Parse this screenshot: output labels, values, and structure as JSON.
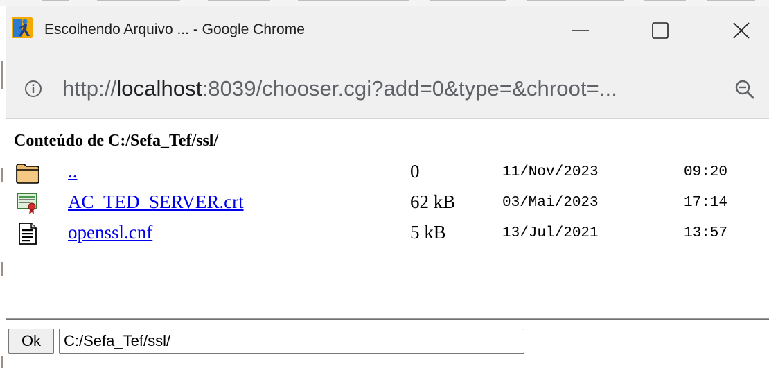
{
  "window": {
    "title": "Escolhendo Arquivo ... - Google Chrome",
    "url_prefix": "http://",
    "url_host": "localhost",
    "url_rest": ":8039/chooser.cgi?add=0&type=&chroot=..."
  },
  "content": {
    "heading": "Conteúdo de C:/Sefa_Tef/ssl/",
    "files": [
      {
        "name": "..",
        "size": "0",
        "date": "11/Nov/2023",
        "time": "09:20",
        "icon": "folder-icon"
      },
      {
        "name": "AC_TED_SERVER.crt",
        "size": "62 kB",
        "date": "03/Mai/2023",
        "time": "17:14",
        "icon": "certificate-icon"
      },
      {
        "name": "openssl.cnf",
        "size": "5 kB",
        "date": "13/Jul/2021",
        "time": "13:57",
        "icon": "text-file-icon"
      }
    ]
  },
  "footer": {
    "ok_label": "Ok",
    "path_value": "C:/Sefa_Tef/ssl/"
  }
}
